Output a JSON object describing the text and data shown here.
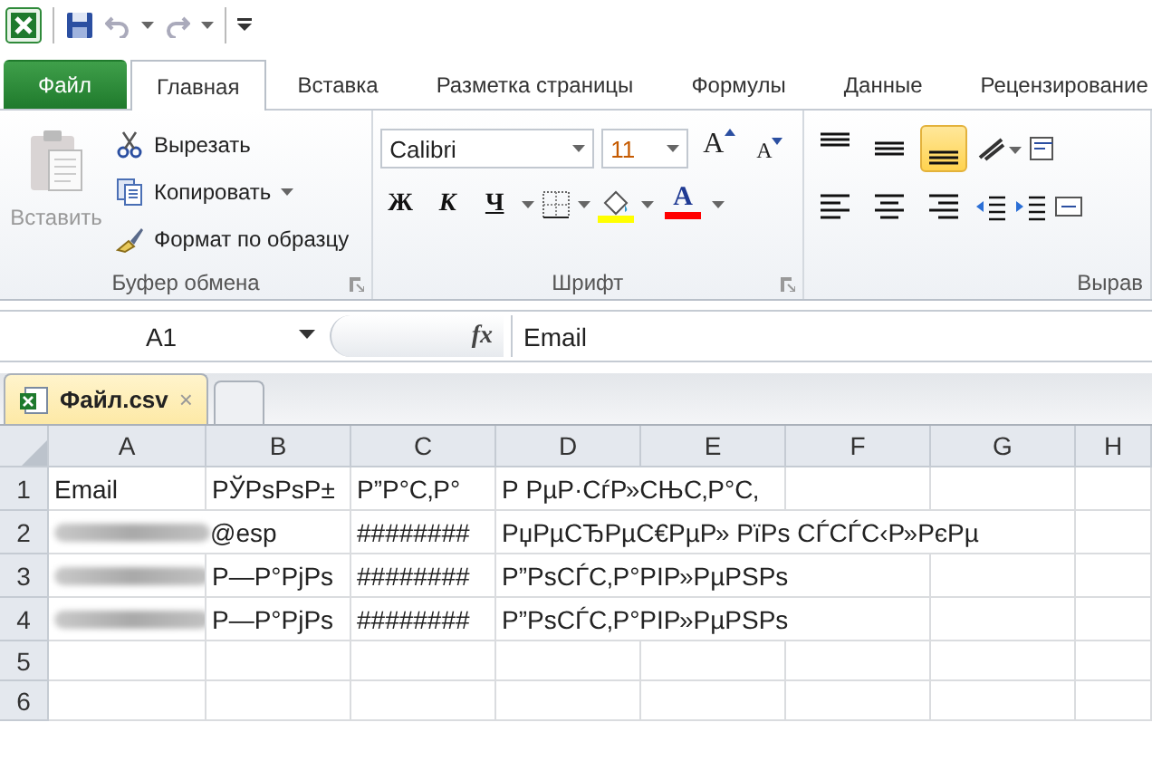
{
  "tabs": [
    {
      "label": "Файл",
      "kind": "file",
      "selected": false
    },
    {
      "label": "Главная",
      "kind": "tab",
      "selected": true
    },
    {
      "label": "Вставка",
      "kind": "tab",
      "selected": false
    },
    {
      "label": "Разметка страницы",
      "kind": "tab",
      "selected": false
    },
    {
      "label": "Формулы",
      "kind": "tab",
      "selected": false
    },
    {
      "label": "Данные",
      "kind": "tab",
      "selected": false
    },
    {
      "label": "Рецензирование",
      "kind": "tab",
      "selected": false
    }
  ],
  "clipboard": {
    "title": "Буфер обмена",
    "paste": {
      "label": "Вставить",
      "disabled": true
    },
    "commands": [
      {
        "label": "Вырезать",
        "kind": "cut",
        "menu": false
      },
      {
        "label": "Копировать",
        "kind": "copy",
        "menu": true
      },
      {
        "label": "Формат по образцу",
        "kind": "format-painter",
        "menu": false
      }
    ]
  },
  "font": {
    "title": "Шрифт",
    "name": "Calibri",
    "size": "11",
    "grow": "A",
    "shrink": "A",
    "styles": [
      {
        "label": "Ж",
        "kind": "bold"
      },
      {
        "label": "К",
        "kind": "italic"
      },
      {
        "label": "Ч",
        "kind": "underline"
      }
    ],
    "font_color": {
      "label": "A"
    }
  },
  "alignment": {
    "title": "Вырав",
    "vertical": [
      {
        "kind": "top",
        "selected": false
      },
      {
        "kind": "middle",
        "selected": false
      },
      {
        "kind": "bottom",
        "selected": true
      }
    ],
    "horizontal": [
      {
        "kind": "left"
      },
      {
        "kind": "center"
      },
      {
        "kind": "right"
      }
    ]
  },
  "formula_bar": {
    "name_box": "A1",
    "function_label": "fx",
    "value": "Email"
  },
  "sheet_tabs": [
    {
      "label": "Файл.csv",
      "close": "×",
      "selected": true
    }
  ],
  "columns": [
    "A",
    "B",
    "C",
    "D",
    "E",
    "F",
    "G",
    "H"
  ],
  "rows": [
    {
      "number": "1",
      "cells": [
        {
          "kind": "text",
          "text": "Email"
        },
        {
          "kind": "text",
          "text": "РЎРѕРѕР±"
        },
        {
          "kind": "text",
          "text": "Р”Р°С‚Р°"
        },
        {
          "kind": "text",
          "text": "Р РµР·СѓР»СЊС‚Р°С‚"
        }
      ]
    },
    {
      "number": "2",
      "cells": [
        {
          "kind": "blurred",
          "text": "@esp"
        },
        {
          "kind": "empty"
        },
        {
          "kind": "text",
          "text": "########"
        },
        {
          "kind": "text",
          "text": "РџРµСЂРµС€РµР» РїРѕ СЃСЃС‹Р»РєРµ"
        }
      ]
    },
    {
      "number": "3",
      "cells": [
        {
          "kind": "blurred"
        },
        {
          "kind": "text",
          "text": "Р—Р°РјРѕ"
        },
        {
          "kind": "text",
          "text": "########"
        },
        {
          "kind": "text",
          "text": "Р”РѕСЃС‚Р°РІР»РµРЅРѕ"
        }
      ]
    },
    {
      "number": "4",
      "cells": [
        {
          "kind": "blurred"
        },
        {
          "kind": "text",
          "text": "Р—Р°РјРѕ"
        },
        {
          "kind": "text",
          "text": "########"
        },
        {
          "kind": "text",
          "text": "Р”РѕСЃС‚Р°РІР»РµРЅРѕ"
        }
      ]
    },
    {
      "number": "5",
      "cells": []
    },
    {
      "number": "6",
      "cells": []
    }
  ]
}
